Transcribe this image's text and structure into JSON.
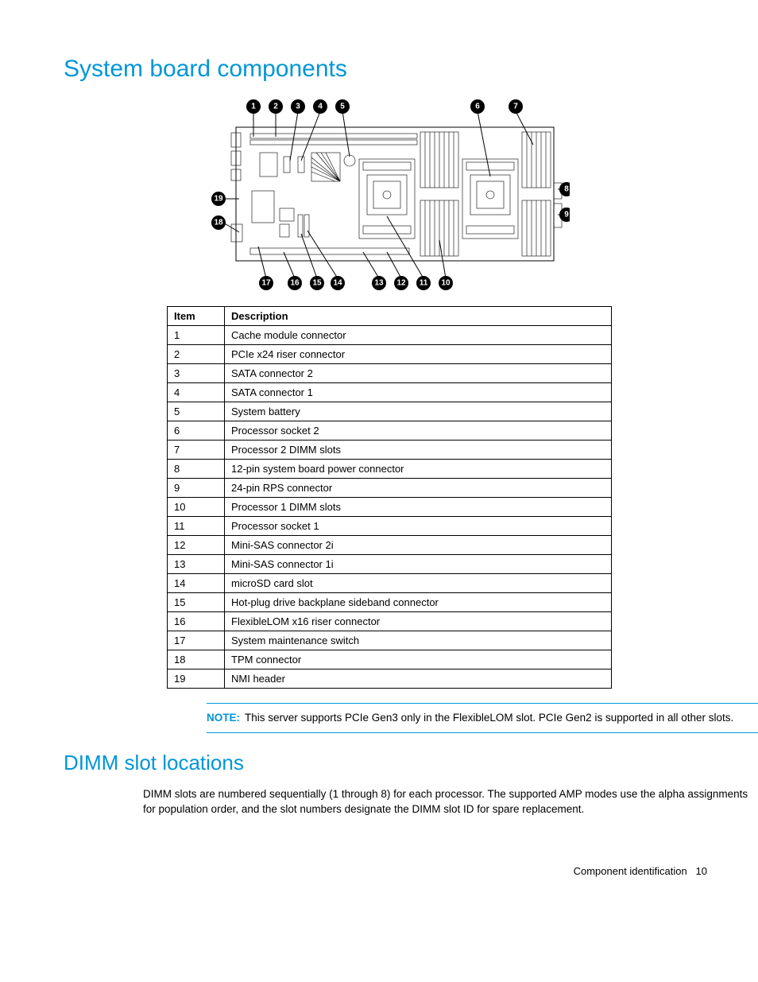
{
  "headings": {
    "h1": "System board components",
    "h2": "DIMM slot locations"
  },
  "table": {
    "headers": {
      "item": "Item",
      "description": "Description"
    },
    "rows": [
      {
        "item": "1",
        "desc": "Cache module connector"
      },
      {
        "item": "2",
        "desc": "PCIe x24 riser connector"
      },
      {
        "item": "3",
        "desc": "SATA connector 2"
      },
      {
        "item": "4",
        "desc": "SATA connector 1"
      },
      {
        "item": "5",
        "desc": "System battery"
      },
      {
        "item": "6",
        "desc": "Processor socket 2"
      },
      {
        "item": "7",
        "desc": "Processor 2 DIMM slots"
      },
      {
        "item": "8",
        "desc": "12-pin system board power connector"
      },
      {
        "item": "9",
        "desc": "24-pin RPS connector"
      },
      {
        "item": "10",
        "desc": "Processor 1 DIMM slots"
      },
      {
        "item": "11",
        "desc": "Processor socket 1"
      },
      {
        "item": "12",
        "desc": "Mini-SAS connector 2i"
      },
      {
        "item": "13",
        "desc": "Mini-SAS connector 1i"
      },
      {
        "item": "14",
        "desc": "microSD card slot"
      },
      {
        "item": "15",
        "desc": "Hot-plug drive backplane sideband connector"
      },
      {
        "item": "16",
        "desc": "FlexibleLOM x16 riser connector"
      },
      {
        "item": "17",
        "desc": "System maintenance switch"
      },
      {
        "item": "18",
        "desc": "TPM connector"
      },
      {
        "item": "19",
        "desc": "NMI header"
      }
    ]
  },
  "note": {
    "label": "NOTE:",
    "text": "This server supports PCIe Gen3 only in the FlexibleLOM slot. PCIe Gen2 is supported in all other slots."
  },
  "body_para": "DIMM slots are numbered sequentially (1 through 8) for each processor. The supported AMP modes use the alpha assignments for population order, and the slot numbers designate the DIMM slot ID for spare replacement.",
  "footer": {
    "section": "Component identification",
    "page": "10"
  },
  "callouts": {
    "top": [
      "1",
      "2",
      "3",
      "4",
      "5",
      "6",
      "7"
    ],
    "right": [
      "8",
      "9"
    ],
    "left": [
      "19",
      "18"
    ],
    "bottom": [
      "17",
      "16",
      "15",
      "14",
      "13",
      "12",
      "11",
      "10"
    ]
  }
}
